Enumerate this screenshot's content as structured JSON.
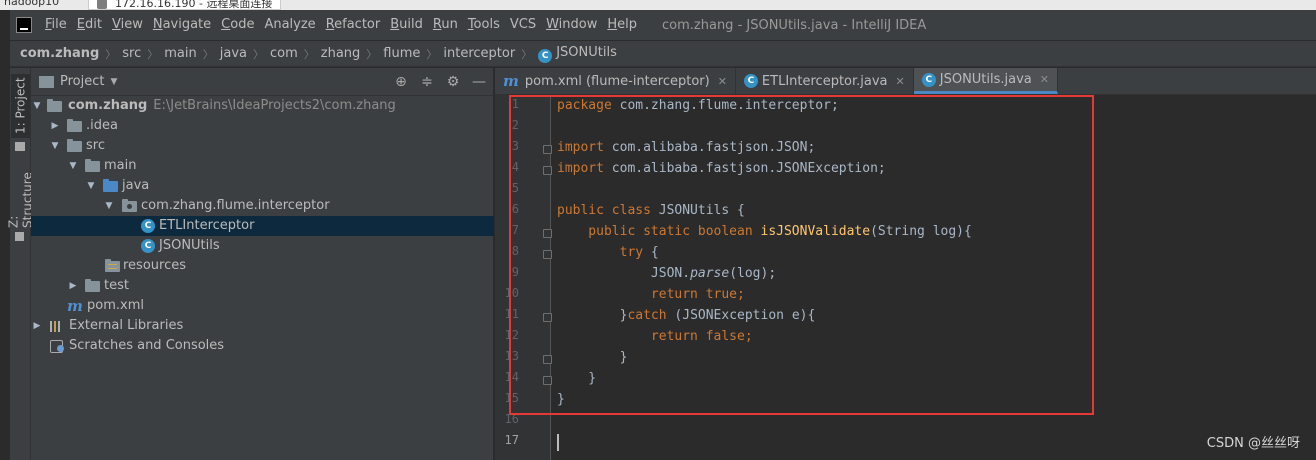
{
  "rdp": {
    "left_text": "hadoop10",
    "tab_text": "172.16.16.190 - 远程桌面连接"
  },
  "menu": {
    "items": [
      {
        "mn": "F",
        "rest": "ile"
      },
      {
        "mn": "E",
        "rest": "dit"
      },
      {
        "mn": "V",
        "rest": "iew"
      },
      {
        "mn": "N",
        "rest": "avigate"
      },
      {
        "mn": "C",
        "rest": "ode"
      },
      {
        "mn": "",
        "rest": "Analyze"
      },
      {
        "mn": "R",
        "rest": "efactor"
      },
      {
        "mn": "B",
        "rest": "uild"
      },
      {
        "mn": "R",
        "rest": "un"
      },
      {
        "mn": "T",
        "rest": "ools"
      },
      {
        "mn": "",
        "rest": "VCS"
      },
      {
        "mn": "W",
        "rest": "indow"
      },
      {
        "mn": "H",
        "rest": "elp"
      }
    ],
    "window_title": "com.zhang - JSONUtils.java - IntelliJ IDEA"
  },
  "breadcrumb": [
    "com.zhang",
    "src",
    "main",
    "java",
    "com",
    "zhang",
    "flume",
    "interceptor",
    "JSONUtils"
  ],
  "left_strip": {
    "project_tab": "1: Project",
    "structure_tab": "Z: Structure"
  },
  "project_panel": {
    "title": "Project",
    "tree": {
      "root_label": "com.zhang",
      "root_path": "E:\\JetBrains\\IdeaProjects2\\com.zhang",
      "idea": ".idea",
      "src": "src",
      "main": "main",
      "java": "java",
      "package": "com.zhang.flume.interceptor",
      "class1": "ETLInterceptor",
      "class2": "JSONUtils",
      "resources": "resources",
      "test": "test",
      "pom": "pom.xml",
      "ext_libs": "External Libraries",
      "scratches": "Scratches and Consoles"
    }
  },
  "editor_tabs": [
    {
      "label": "pom.xml (flume-interceptor)",
      "icon": "maven-icon"
    },
    {
      "label": "ETLInterceptor.java",
      "icon": "class-icon"
    },
    {
      "label": "JSONUtils.java",
      "icon": "class-icon",
      "active": true
    }
  ],
  "editor": {
    "line_numbers": [
      "1",
      "2",
      "3",
      "4",
      "5",
      "6",
      "7",
      "8",
      "9",
      "10",
      "11",
      "12",
      "13",
      "14",
      "15",
      "16",
      "17"
    ],
    "code": {
      "l1_kw": "package",
      "l1_rest": " com.zhang.flume.interceptor;",
      "l3_kw": "import",
      "l3_rest": " com.alibaba.fastjson.JSON;",
      "l4_kw": "import",
      "l4_rest": " com.alibaba.fastjson.JSONException;",
      "l6_kw": "public class",
      "l6_rest": " JSONUtils {",
      "l7_kw": "    public static boolean",
      "l7_fn": " isJSONValidate",
      "l7_rest": "(String log){",
      "l8_kw": "        try",
      "l8_rest": " {",
      "l9_pre": "            JSON.",
      "l9_it": "parse",
      "l9_rest": "(log);",
      "l10_kw": "            return true",
      "l10_rest": ";",
      "l11_pre": "        }",
      "l11_kw": "catch",
      "l11_rest": " (JSONException e){",
      "l12_kw": "            return false",
      "l12_rest": ";",
      "l13": "        }",
      "l14": "    }",
      "l15": "}"
    }
  },
  "watermark": "CSDN @丝丝呀",
  "colors": {
    "keyword": "#cc7832",
    "method": "#ffc66d",
    "text": "#a9b7c6",
    "highlight_box": "#e53935",
    "selection": "#0d293e"
  }
}
